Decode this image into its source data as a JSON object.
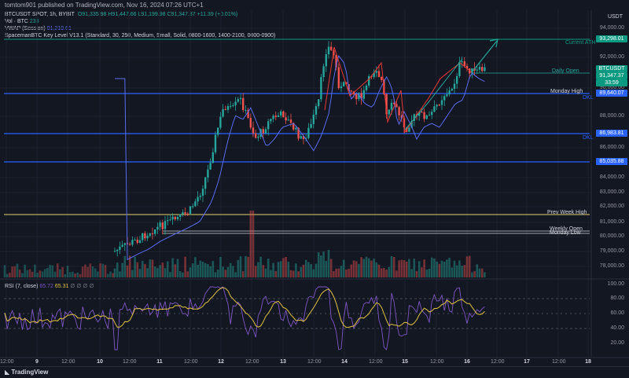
{
  "header": {
    "published": "tomtom901 published on TradingView.com, Nov 16, 2024 07:26 UTC+1",
    "currency": "USDT"
  },
  "legend": {
    "symbol": "BTCUSDT SPOT, 1h, BYBIT",
    "ohlc": "O91,335.98 H91,447.66 L91,199.98 C91,347.37 +11.39 (+0.01%)",
    "vol_label": "Vol · BTC",
    "vol_value": "233",
    "vwap_label": "VWAP (Session)",
    "vwap_value": "91,219.61",
    "indicator": "SpacemanBTC Key Level V13.1 (Standard, 30, 250, Medium, Small, Solid, 0800-1600, 1400-2100, 0000-0900)"
  },
  "price_axis": {
    "ticks": [
      "94,000.00",
      "92,000.00",
      "90,000.00",
      "88,000.00",
      "86,000.00",
      "84,000.00",
      "83,000.00",
      "82,000.00",
      "81,000.00",
      "80,000.00",
      "79,000.00",
      "78,000.00"
    ],
    "boxes": [
      {
        "label": "93,298.01",
        "color": "#089981"
      },
      {
        "label": "BTCUSDT",
        "color": "#089981"
      },
      {
        "label": "91,347.37",
        "color": "#089981"
      },
      {
        "label": "33:59",
        "color": "#089981"
      },
      {
        "label": "89,640.07",
        "color": "#2962ff"
      },
      {
        "label": "86,983.81",
        "color": "#2962ff"
      },
      {
        "label": "85,035.88",
        "color": "#2962ff"
      }
    ]
  },
  "levels": {
    "current_ath": "Current ATH",
    "daily_open": "Daily Open",
    "monday_high": "Monday High",
    "dkl1": "DKL",
    "dkl2": "DKL",
    "prev_week_high": "Prev Week High",
    "weekly_open": "Weekly Open",
    "monday_low": "Monday Low"
  },
  "rsi": {
    "label": "RSI (7, close)",
    "value1": "65.72",
    "value2": "65.31",
    "extra": "∅ ∅ ∅ ∅",
    "ticks": [
      "100.00",
      "80.00",
      "60.00",
      "40.00",
      "20.00"
    ]
  },
  "time_axis": {
    "labels": [
      "12:00",
      "9",
      "12:00",
      "10",
      "12:00",
      "11",
      "12:00",
      "12",
      "12:00",
      "13",
      "12:00",
      "14",
      "12:00",
      "15",
      "12:00",
      "16",
      "12:00",
      "17",
      "12:00",
      "18"
    ]
  },
  "footer": {
    "brand": "TradingView"
  },
  "colors": {
    "up": "#26a69a",
    "down": "#ef5350",
    "vwap": "#5b6cf0",
    "level_blue": "#2962ff",
    "level_yellow": "#e0d06b",
    "ath": "#089981"
  }
}
